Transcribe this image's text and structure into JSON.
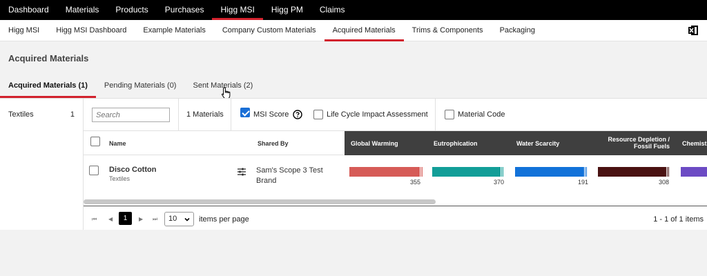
{
  "topnav": [
    "Dashboard",
    "Materials",
    "Products",
    "Purchases",
    "Higg MSI",
    "Higg PM",
    "Claims"
  ],
  "subnav": [
    "Higg MSI",
    "Higg MSI Dashboard",
    "Example Materials",
    "Company Custom Materials",
    "Acquired Materials",
    "Trims & Components",
    "Packaging"
  ],
  "page_title": "Acquired Materials",
  "tabs": [
    "Acquired Materials (1)",
    "Pending Materials (0)",
    "Sent Materials (2)"
  ],
  "sidebar": {
    "category": "Textiles",
    "count": "1"
  },
  "toolbar": {
    "search_placeholder": "Search",
    "count_text": "1 Materials",
    "msi_score_label": "MSI Score",
    "lca_label": "Life Cycle Impact Assessment",
    "material_code_label": "Material Code"
  },
  "table": {
    "headers": {
      "name": "Name",
      "shared_by": "Shared By",
      "global_warming": "Global Warming",
      "eutrophication": "Eutrophication",
      "water_scarcity": "Water Scarcity",
      "resource_depletion_1": "Resource Depletion /",
      "resource_depletion_2": "Fossil Fuels",
      "chemistry": "Chemist"
    },
    "row": {
      "name": "Disco Cotton",
      "category": "Textiles",
      "shared_by": "Sam's Scope 3 Test Brand",
      "values": {
        "global_warming": "355",
        "eutrophication": "370",
        "water_scarcity": "191",
        "resource_depletion": "308"
      }
    }
  },
  "pager": {
    "first": "⏮",
    "prev": "◀",
    "current_page": "1",
    "next": "▶",
    "last": "⏭",
    "per_page": "10",
    "per_page_label": "items per page",
    "range": "1 - 1 of 1 items"
  },
  "colors": {
    "accent_red": "#d2222d",
    "global_warming": "#d65b57",
    "eutrophication": "#129e98",
    "water_scarcity": "#1272d9",
    "resource_depletion": "#4a1212",
    "chemistry": "#6c4bc4"
  }
}
